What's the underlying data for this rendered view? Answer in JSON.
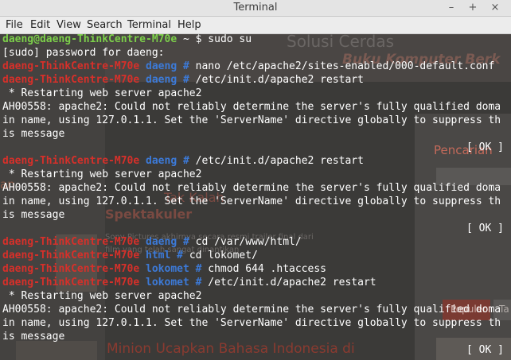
{
  "window": {
    "title": "Terminal",
    "minimize_glyph": "–",
    "maximize_glyph": "+",
    "close_glyph": "×"
  },
  "menu": {
    "items": [
      "File",
      "Edit",
      "View",
      "Search",
      "Terminal",
      "Help"
    ]
  },
  "background_page": {
    "logo": "Solusi Cerdas",
    "tagline": "Buku Komputer Berk",
    "search_heading": "Pencarian",
    "article_heading_partial": "Spektakuler",
    "article_heading_fragment": "Tak Kalah",
    "snippet_1": "Sony Pictures akhirnya secara resmi trailer final dari",
    "snippet_2": "film yang telah sangat dinantikan",
    "tab_popular": "Populer",
    "tab_other": "Ta",
    "article_2": "Minion Ucapkan Bahasa Indonesia di",
    "left_fragment": "an"
  },
  "terminal": {
    "user_prompt": "daeng@daeng-ThinkCentre-M70e",
    "user_prompt_tail": " ~ $ ",
    "root_host": "daeng-ThinkCentre-M70e",
    "lines": [
      {
        "type": "user",
        "cmd": "sudo su"
      },
      {
        "type": "out",
        "text": "[sudo] password for daeng:"
      },
      {
        "type": "root",
        "dir": "daeng",
        "cmd": "nano /etc/apache2/sites-enabled/000-default.conf"
      },
      {
        "type": "root",
        "dir": "daeng",
        "cmd": "/etc/init.d/apache2 restart"
      },
      {
        "type": "out",
        "text": " * Restarting web server apache2"
      },
      {
        "type": "out",
        "text": "AH00558: apache2: Could not reliably determine the server's fully qualified doma"
      },
      {
        "type": "out",
        "text": "in name, using 127.0.1.1. Set the 'ServerName' directive globally to suppress th"
      },
      {
        "type": "out",
        "text": "is message"
      },
      {
        "type": "out",
        "text": ""
      },
      {
        "type": "root",
        "dir": "daeng",
        "cmd": "/etc/init.d/apache2 restart"
      },
      {
        "type": "out",
        "text": " * Restarting web server apache2"
      },
      {
        "type": "out",
        "text": "AH00558: apache2: Could not reliably determine the server's fully qualified doma"
      },
      {
        "type": "out",
        "text": "in name, using 127.0.1.1. Set the 'ServerName' directive globally to suppress th"
      },
      {
        "type": "out",
        "text": "is message"
      },
      {
        "type": "out",
        "text": ""
      },
      {
        "type": "root",
        "dir": "daeng",
        "cmd": "cd /var/www/html/"
      },
      {
        "type": "root",
        "dir": "html",
        "cmd": "cd lokomet/"
      },
      {
        "type": "root",
        "dir": "lokomet",
        "cmd": "chmod 644 .htaccess"
      },
      {
        "type": "root",
        "dir": "lokomet",
        "cmd": "/etc/init.d/apache2 restart"
      },
      {
        "type": "out",
        "text": " * Restarting web server apache2"
      },
      {
        "type": "out",
        "text": "AH00558: apache2: Could not reliably determine the server's fully qualified doma"
      },
      {
        "type": "out",
        "text": "in name, using 127.0.1.1. Set the 'ServerName' directive globally to suppress th"
      },
      {
        "type": "out",
        "text": "is message"
      },
      {
        "type": "out",
        "text": ""
      }
    ],
    "ok_status": "[ OK ]",
    "ok_lines": [
      8,
      14,
      23
    ]
  },
  "colors": {
    "user_prompt": "#7ccf4a",
    "root_host": "#d6302a",
    "directory": "#3c7ad8",
    "text": "#ffffff",
    "terminal_bg": "#3b3a38"
  }
}
